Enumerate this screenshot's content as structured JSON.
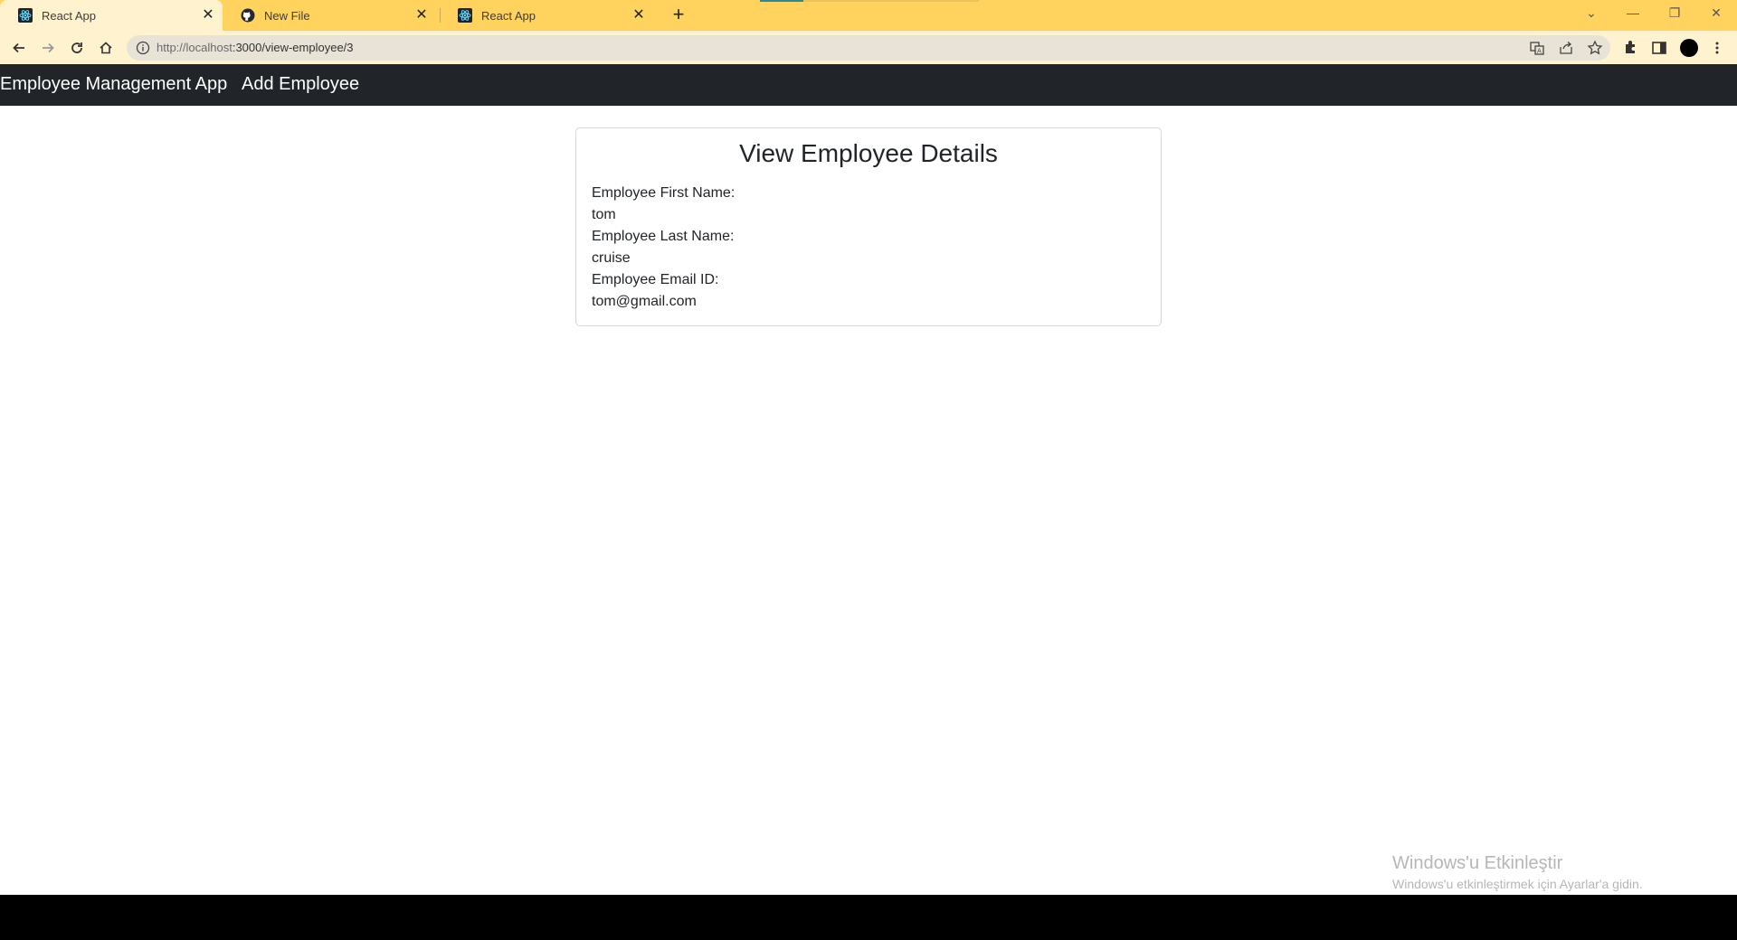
{
  "browser": {
    "tabs": [
      {
        "title": "React App",
        "icon": "react-icon",
        "active": true
      },
      {
        "title": "New File",
        "icon": "github-icon",
        "active": false
      },
      {
        "title": "React App",
        "icon": "react-icon",
        "active": false
      }
    ],
    "new_tab": "+",
    "url_host": "http://localhost",
    "url_path": ":3000/view-employee/3",
    "window_controls": {
      "minimize": "—",
      "restore": "❐",
      "close": "✕",
      "tabsearch": "⌄"
    }
  },
  "app": {
    "brand": "Employee Management App",
    "nav_link": "Add Employee"
  },
  "card": {
    "title": "View Employee Details",
    "fields": [
      {
        "label": "Employee First Name:",
        "value": "tom"
      },
      {
        "label": "Employee Last Name:",
        "value": "cruise"
      },
      {
        "label": "Employee Email ID:",
        "value": "tom@gmail.com"
      }
    ]
  },
  "watermark": {
    "line1": "Windows'u Etkinleştir",
    "line2": "Windows'u etkinleştirmek için Ayarlar'a gidin."
  },
  "colors": {
    "tabbar": "#ffd35e",
    "toolbar": "#fff3cf",
    "app_nav": "#212529"
  }
}
